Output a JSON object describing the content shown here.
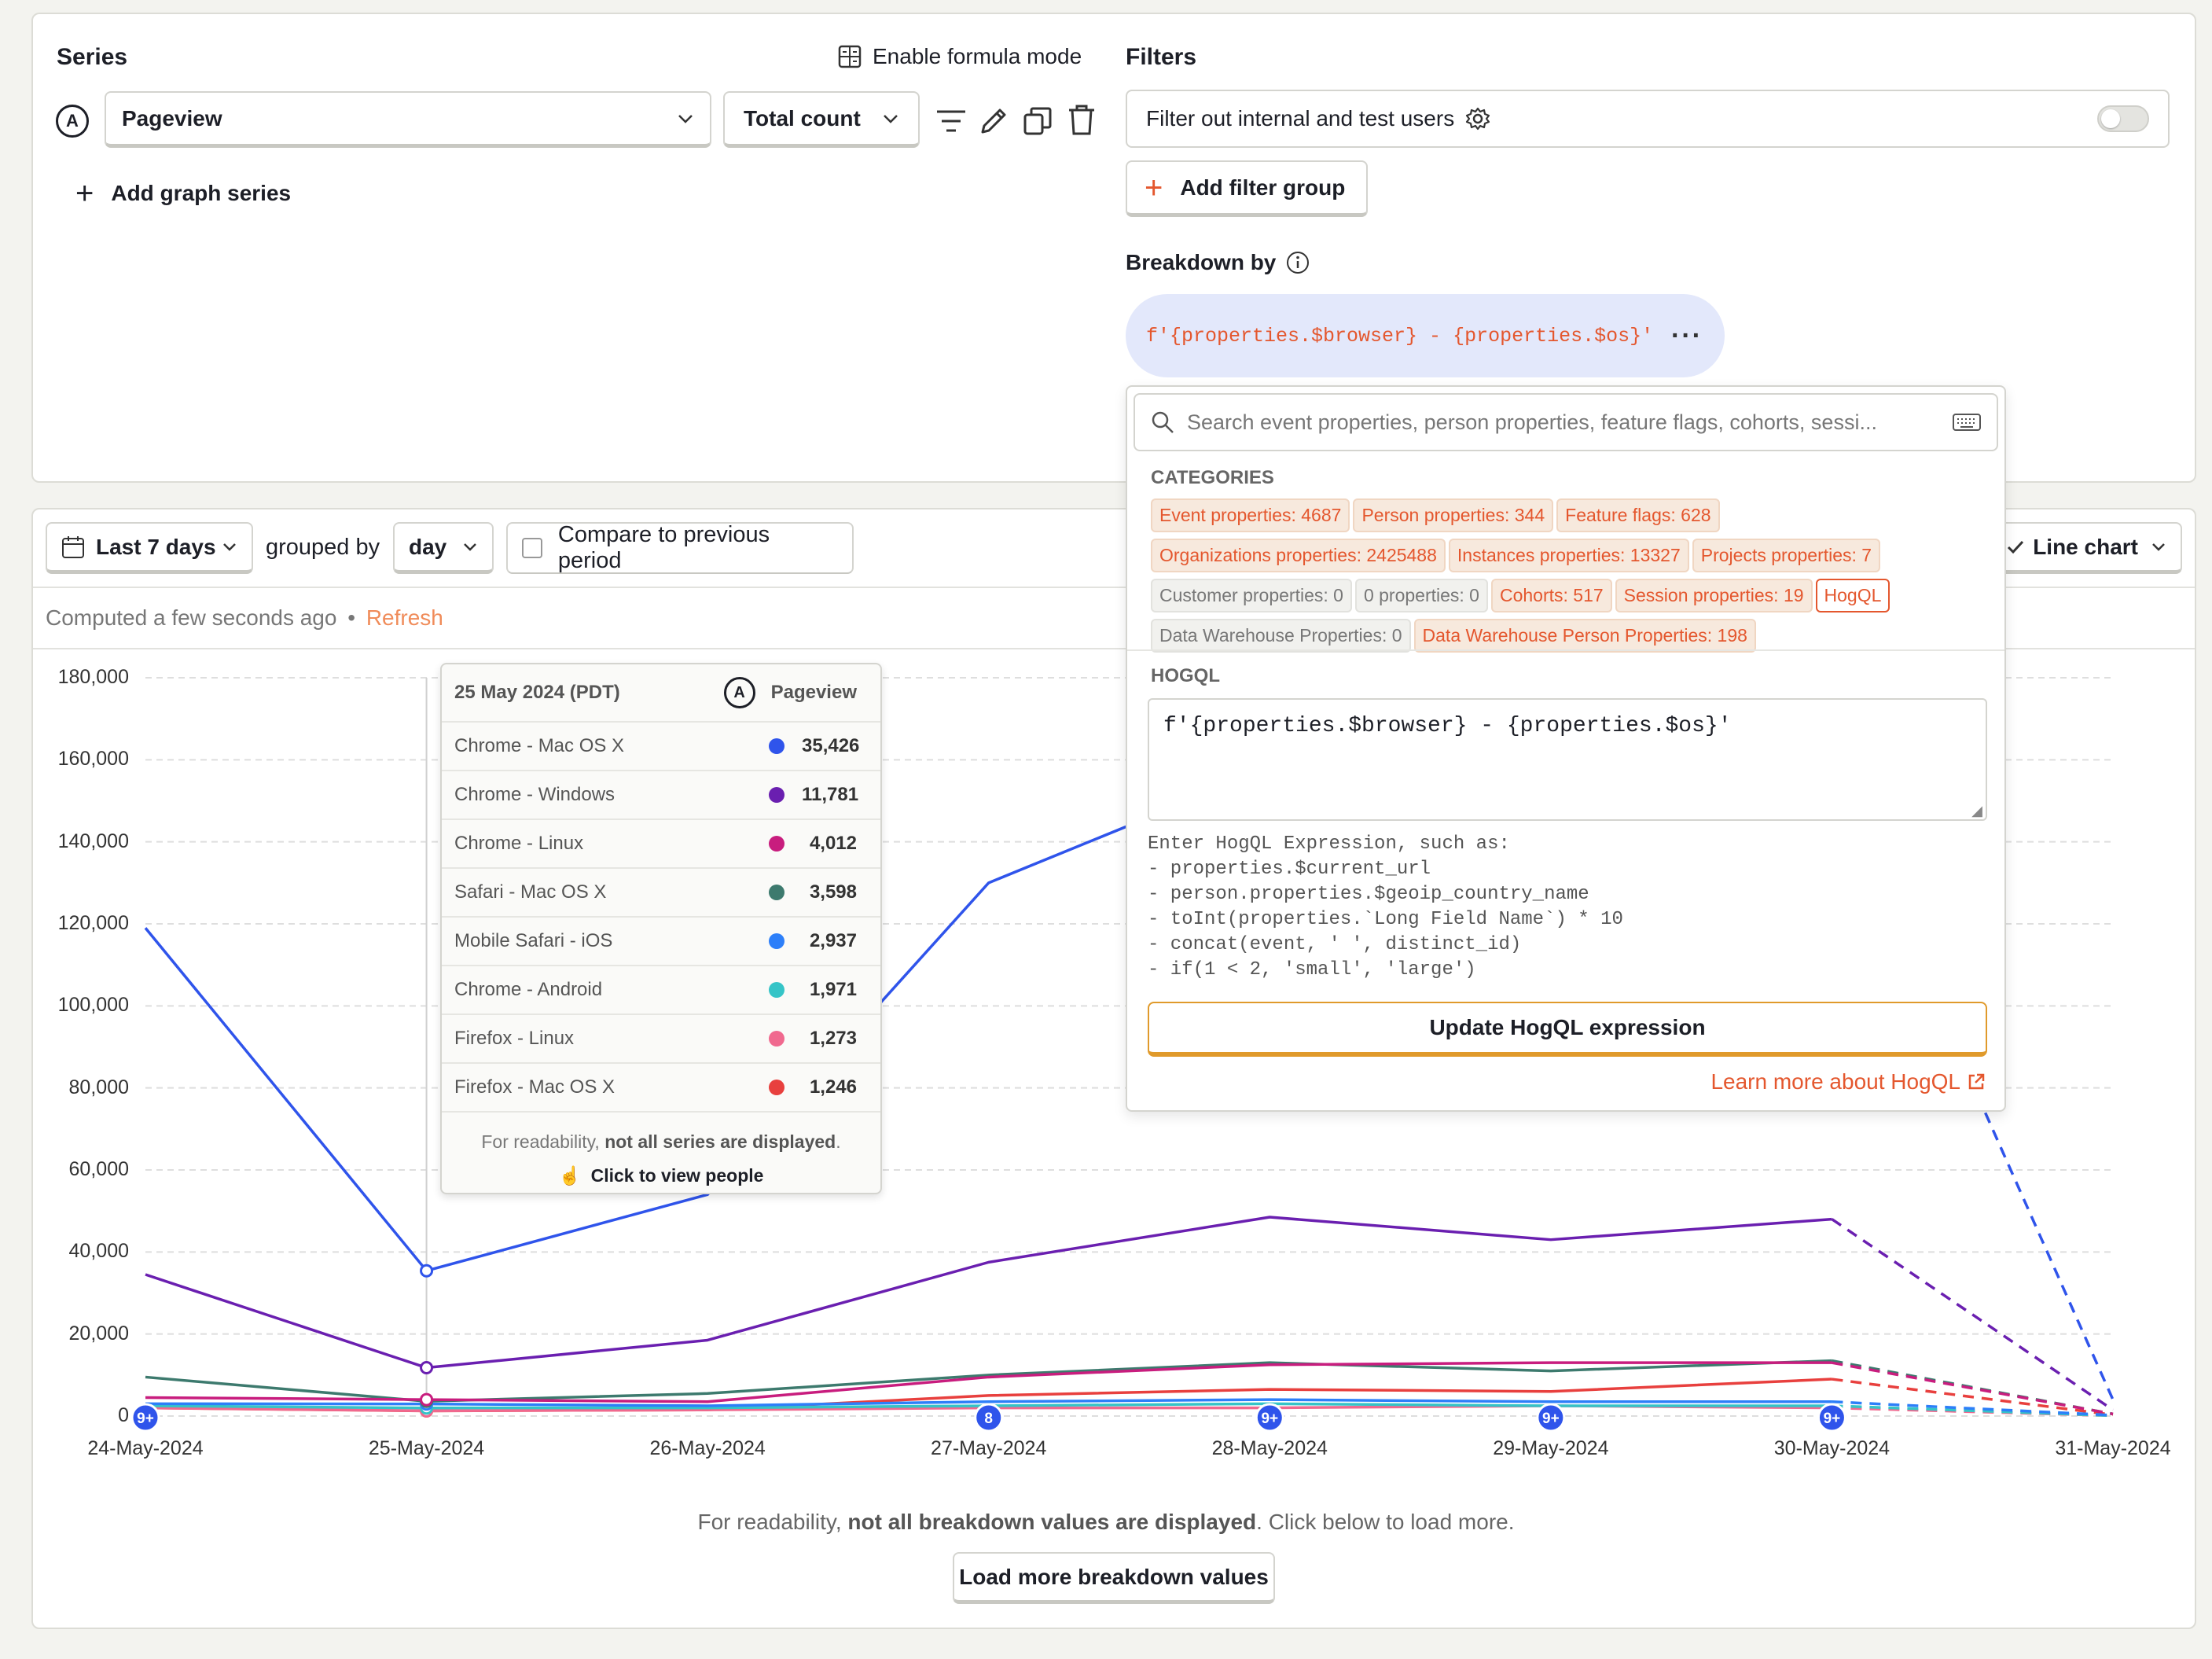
{
  "series_section": {
    "title": "Series",
    "formula_mode_label": "Enable formula mode",
    "series_letter": "A",
    "event_name": "Pageview",
    "aggregation": "Total count",
    "add_series_label": "Add graph series"
  },
  "filters_section": {
    "title": "Filters",
    "internal_filter_label": "Filter out internal and test users",
    "add_filter_group_label": "Add filter group",
    "breakdown_label": "Breakdown by",
    "breakdown_value": "f'{properties.$browser} - {properties.$os}'"
  },
  "popover": {
    "search_placeholder": "Search event properties, person properties, feature flags, cohorts, sessi...",
    "categories_heading": "CATEGORIES",
    "categories": [
      {
        "label": "Event properties: 4687",
        "style": "orange"
      },
      {
        "label": "Person properties: 344",
        "style": "orange"
      },
      {
        "label": "Feature flags: 628",
        "style": "orange"
      },
      {
        "label": "Organizations properties: 2425488",
        "style": "orange"
      },
      {
        "label": "Instances properties: 13327",
        "style": "orange"
      },
      {
        "label": "Projects properties: 7",
        "style": "orange"
      },
      {
        "label": "Customer properties: 0",
        "style": "grey"
      },
      {
        "label": "0 properties: 0",
        "style": "grey"
      },
      {
        "label": "Cohorts: 517",
        "style": "orange"
      },
      {
        "label": "Session properties: 19",
        "style": "orange"
      },
      {
        "label": "HogQL",
        "style": "selected"
      },
      {
        "label": "Data Warehouse Properties: 0",
        "style": "grey"
      },
      {
        "label": "Data Warehouse Person Properties: 198",
        "style": "orange"
      }
    ],
    "hogql_heading": "HOGQL",
    "hogql_value": "f'{properties.$browser} - {properties.$os}'",
    "hint_lines": [
      "Enter HogQL Expression, such as:",
      "- properties.$current_url",
      "- person.properties.$geoip_country_name",
      "- toInt(properties.`Long Field Name`) * 10",
      "- concat(event, ' ', distinct_id)",
      "- if(1 < 2, 'small', 'large')"
    ],
    "update_button": "Update HogQL expression",
    "learn_more": "Learn more about HogQL"
  },
  "toolbar": {
    "date_range": "Last 7 days",
    "grouped_by_label": "grouped by",
    "interval": "day",
    "compare_label": "Compare to previous period",
    "chart_type": "Line chart",
    "computed_text": "Computed a few seconds ago",
    "refresh": "Refresh"
  },
  "tooltip": {
    "date": "25 May 2024 (PDT)",
    "series_letter": "A",
    "series_name": "Pageview",
    "rows": [
      {
        "name": "Chrome - Mac OS X",
        "value": "35,426",
        "color": "#2f54eb"
      },
      {
        "name": "Chrome - Windows",
        "value": "11,781",
        "color": "#6a1fb0"
      },
      {
        "name": "Chrome - Linux",
        "value": "4,012",
        "color": "#c81d7e"
      },
      {
        "name": "Safari - Mac OS X",
        "value": "3,598",
        "color": "#3d7a6e"
      },
      {
        "name": "Mobile Safari - iOS",
        "value": "2,937",
        "color": "#2d7ff9"
      },
      {
        "name": "Chrome - Android",
        "value": "1,971",
        "color": "#35c4c7"
      },
      {
        "name": "Firefox - Linux",
        "value": "1,273",
        "color": "#f0698f"
      },
      {
        "name": "Firefox - Mac OS X",
        "value": "1,246",
        "color": "#e8403e"
      }
    ],
    "footer_prefix": "For readability, ",
    "footer_bold": "not all series are displayed",
    "footer_suffix": ".",
    "click_label": "Click to view people"
  },
  "chart_data": {
    "type": "line",
    "x": [
      "24-May-2024",
      "25-May-2024",
      "26-May-2024",
      "27-May-2024",
      "28-May-2024",
      "29-May-2024",
      "30-May-2024",
      "31-May-2024"
    ],
    "ylim": [
      0,
      180000
    ],
    "yticks": [
      "180,000",
      "160,000",
      "140,000",
      "120,000",
      "100,000",
      "80,000",
      "60,000",
      "40,000",
      "20,000",
      "0"
    ],
    "grid": true,
    "last_point_dashed": true,
    "series": [
      {
        "name": "Chrome - Mac OS X",
        "color": "#2f54eb",
        "values": [
          119000,
          35426,
          54000,
          130000,
          158000,
          156000,
          158000,
          4000
        ]
      },
      {
        "name": "Chrome - Windows",
        "color": "#6a1fb0",
        "values": [
          34500,
          11781,
          18500,
          37500,
          48500,
          43000,
          48000,
          1500
        ]
      },
      {
        "name": "Chrome - Linux",
        "color": "#c81d7e",
        "values": [
          4500,
          4012,
          3500,
          9500,
          12500,
          13000,
          13000,
          500
        ]
      },
      {
        "name": "Safari - Mac OS X",
        "color": "#3d7a6e",
        "values": [
          9500,
          3598,
          5500,
          10000,
          13000,
          11000,
          13500,
          500
        ]
      },
      {
        "name": "Mobile Safari - iOS",
        "color": "#2d7ff9",
        "values": [
          3000,
          2937,
          2500,
          3500,
          4000,
          3500,
          3500,
          200
        ]
      },
      {
        "name": "Chrome - Android",
        "color": "#35c4c7",
        "values": [
          2500,
          1971,
          2000,
          2500,
          3000,
          2500,
          2500,
          100
        ]
      },
      {
        "name": "Firefox - Linux",
        "color": "#f0698f",
        "values": [
          2000,
          1273,
          1500,
          2000,
          2000,
          2500,
          2000,
          100
        ]
      },
      {
        "name": "Firefox - Mac OS X",
        "color": "#e8403e",
        "values": [
          2000,
          1246,
          1500,
          5000,
          6500,
          6000,
          9000,
          300
        ]
      }
    ],
    "markers": [
      {
        "x": "24-May-2024",
        "label": "9+"
      },
      {
        "x": "27-May-2024",
        "label": "8"
      },
      {
        "x": "28-May-2024",
        "label": "9+"
      },
      {
        "x": "29-May-2024",
        "label": "9+"
      },
      {
        "x": "30-May-2024",
        "label": "9+"
      }
    ]
  },
  "footer": {
    "note_prefix": "For readability, ",
    "note_bold": "not all breakdown values are displayed",
    "note_suffix": ". Click below to load more.",
    "load_more": "Load more breakdown values"
  }
}
